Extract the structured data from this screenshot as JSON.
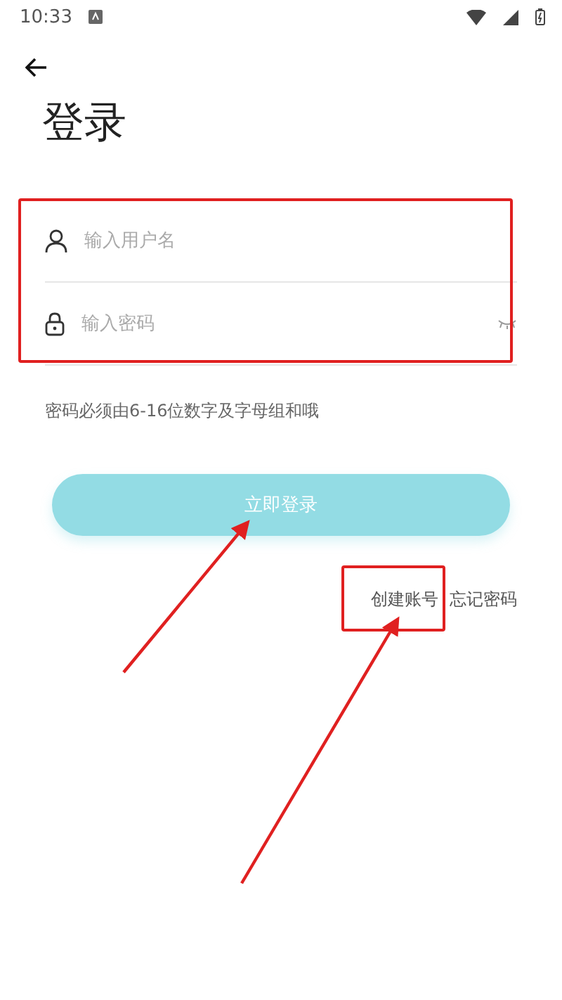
{
  "status_bar": {
    "time": "10:33"
  },
  "title": "登录",
  "fields": [
    {
      "kind": "user",
      "placeholder": "输入用户名"
    },
    {
      "kind": "password",
      "placeholder": "输入密码"
    }
  ],
  "hint": "密码必须由6-16位数字及字母组和哦",
  "login_button": "立即登录",
  "links": [
    "创建账号",
    "忘记密码"
  ]
}
